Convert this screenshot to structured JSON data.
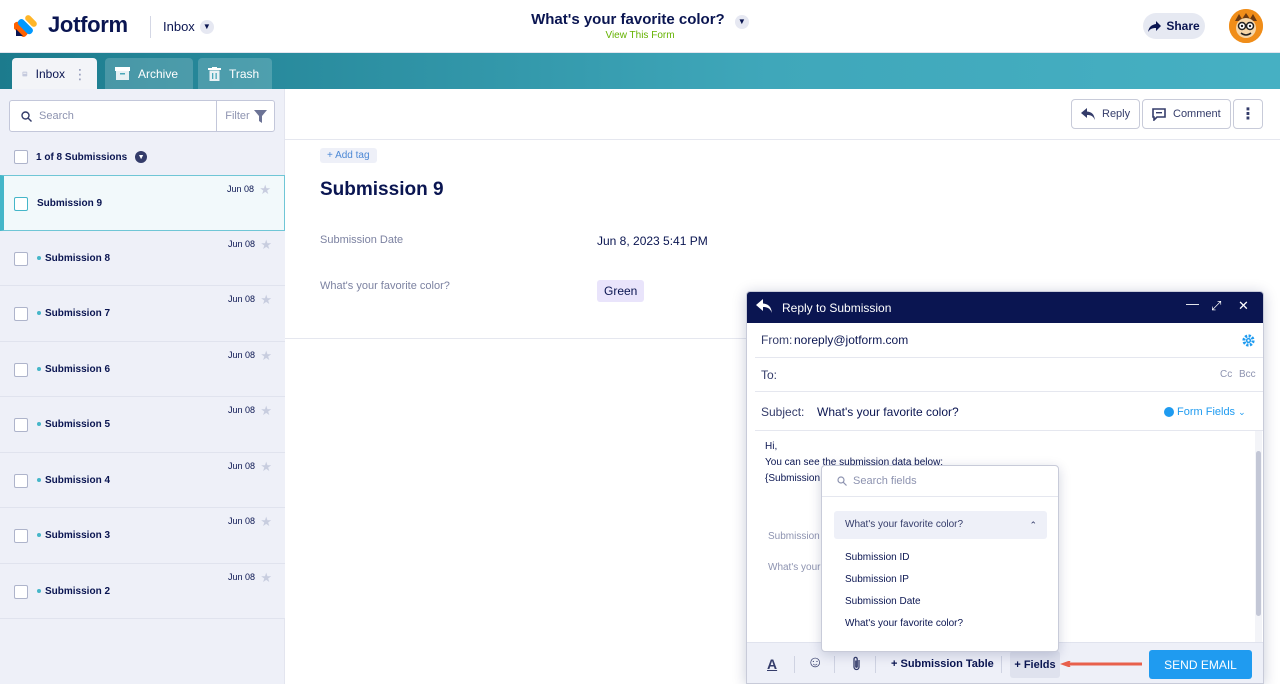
{
  "header": {
    "logo_text": "Jotform",
    "inbox_label": "Inbox",
    "form_title": "What's your favorite color?",
    "view_form_link": "View This Form",
    "share_label": "Share"
  },
  "tabs": [
    {
      "label": "Inbox",
      "icon": "inbox-icon",
      "active": true
    },
    {
      "label": "Archive",
      "icon": "archive-icon",
      "active": false
    },
    {
      "label": "Trash",
      "icon": "trash-icon",
      "active": false
    }
  ],
  "sidebar": {
    "search_placeholder": "Search",
    "filter_label": "Filter",
    "count_label": "1 of 8 Submissions",
    "submissions": [
      {
        "label": "Submission 9",
        "date": "Jun 08",
        "selected": true,
        "unread": false
      },
      {
        "label": "Submission 8",
        "date": "Jun 08",
        "selected": false,
        "unread": true
      },
      {
        "label": "Submission 7",
        "date": "Jun 08",
        "selected": false,
        "unread": true
      },
      {
        "label": "Submission 6",
        "date": "Jun 08",
        "selected": false,
        "unread": true
      },
      {
        "label": "Submission 5",
        "date": "Jun 08",
        "selected": false,
        "unread": true
      },
      {
        "label": "Submission 4",
        "date": "Jun 08",
        "selected": false,
        "unread": true
      },
      {
        "label": "Submission 3",
        "date": "Jun 08",
        "selected": false,
        "unread": true
      },
      {
        "label": "Submission 2",
        "date": "Jun 08",
        "selected": false,
        "unread": true
      }
    ]
  },
  "detail": {
    "reply_label": "Reply",
    "comment_label": "Comment",
    "add_tag_label": "+ Add tag",
    "title": "Submission 9",
    "fields": [
      {
        "label": "Submission Date",
        "value": "Jun 8, 2023 5:41 PM"
      },
      {
        "label": "What's your favorite color?",
        "value": "Green"
      }
    ]
  },
  "reply_modal": {
    "title": "Reply to Submission",
    "from_label": "From:",
    "from_value": "noreply@jotform.com",
    "to_label": "To:",
    "cc_label": "Cc",
    "bcc_label": "Bcc",
    "subject_label": "Subject:",
    "subject_value": "What's your favorite color?",
    "form_fields_label": "Form Fields",
    "body_lines": [
      "Hi,",
      "You can see the submission data below:",
      "{Submission"
    ],
    "body_faded": [
      "Submission",
      "What's your"
    ],
    "submission_table_label": "+ Submission Table",
    "fields_label": "+ Fields",
    "send_label": "SEND EMAIL"
  },
  "fields_popup": {
    "search_placeholder": "Search fields",
    "group_label": "What's your favorite color?",
    "options": [
      "Submission ID",
      "Submission IP",
      "Submission Date",
      "What's your favorite color?"
    ]
  },
  "colors": {
    "navy": "#0a1551",
    "teal": "#45b6c9",
    "send_blue": "#1f9bf0",
    "arrow_red": "#e8604c",
    "view_link_green": "#64b200"
  }
}
